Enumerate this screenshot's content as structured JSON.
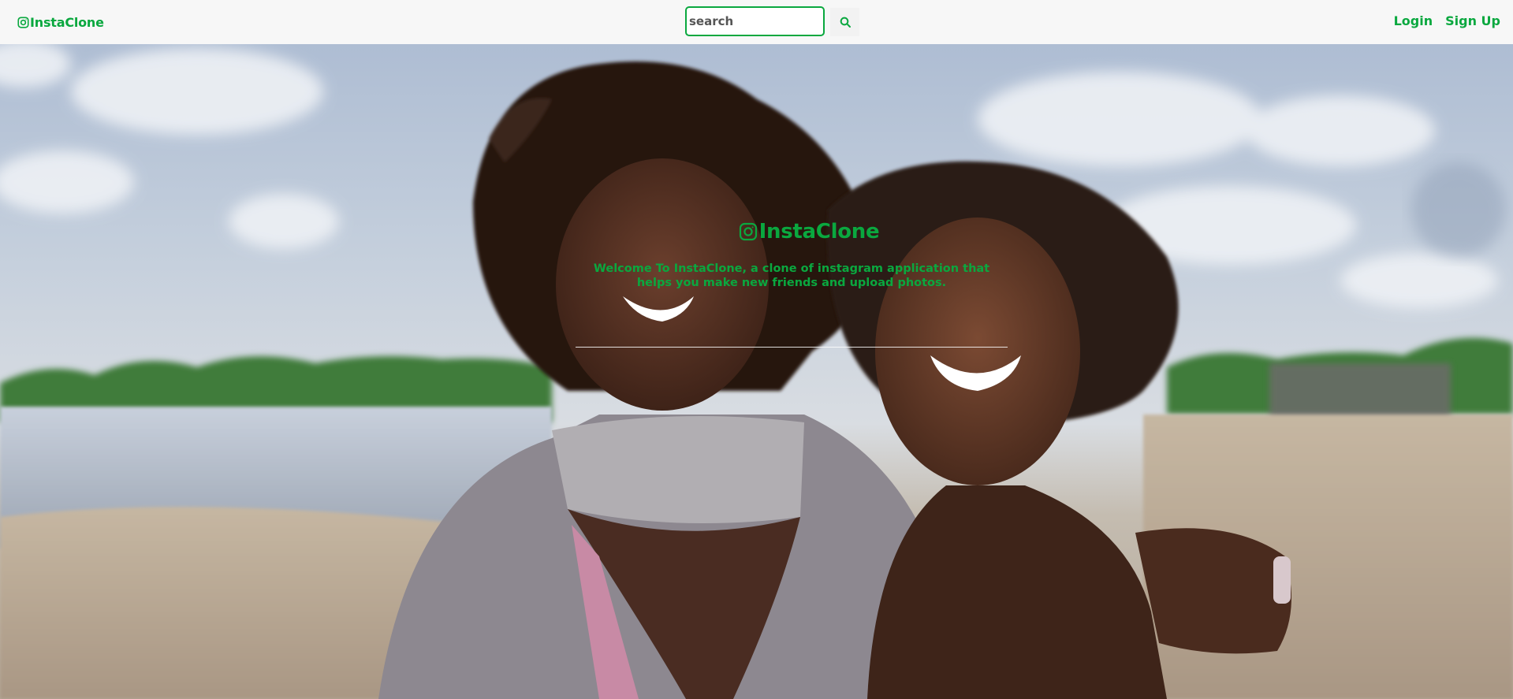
{
  "navbar": {
    "brand": "InstaClone",
    "brand_icon": "instagram-icon",
    "search_placeholder": "search",
    "search_icon": "search-icon",
    "links": [
      "Login",
      "Sign Up"
    ]
  },
  "hero": {
    "title": "InstaClone",
    "title_icon": "instagram-icon",
    "subtitle": "Welcome To InstaClone, a clone of instagram application that helps you make new friends and upload photos."
  },
  "colors": {
    "accent": "#0aa83f",
    "navbar_bg": "#f7f7f7"
  }
}
